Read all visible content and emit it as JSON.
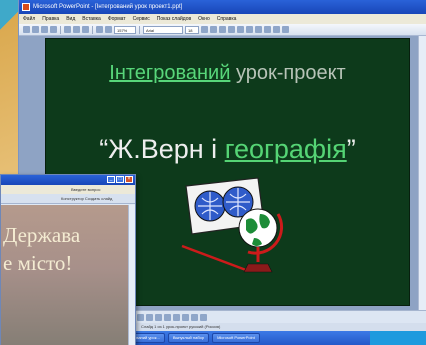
{
  "main_window": {
    "title": "Microsoft PowerPoint - [Інтегрований урок проект1.ppt]",
    "menu": [
      "Файл",
      "Правка",
      "Вид",
      "Вставка",
      "Формат",
      "Сервис",
      "Показ слайдов",
      "Окно",
      "Справка"
    ],
    "zoom": "157%",
    "font_name": "Arial",
    "font_size": "18"
  },
  "slide": {
    "title_hl": "Інтегрований",
    "title_rest": " урок-проект",
    "subtitle_pre": "“Ж.Верн і ",
    "subtitle_hl": "географія",
    "subtitle_post": "”"
  },
  "second_window": {
    "menu_text": "Введите вопрос",
    "toolbar_text": "Конструктор   Создать слайд",
    "slide_text_line1": "Держава",
    "slide_text_line2": "е місто!"
  },
  "status": {
    "text": "Слайд 1 из 1     урок-проект     русский (Россия)"
  },
  "taskbar": {
    "items": [
      "Інтегрований урок...",
      "Выпуклый набор",
      "Microsoft PowerPoint"
    ]
  }
}
